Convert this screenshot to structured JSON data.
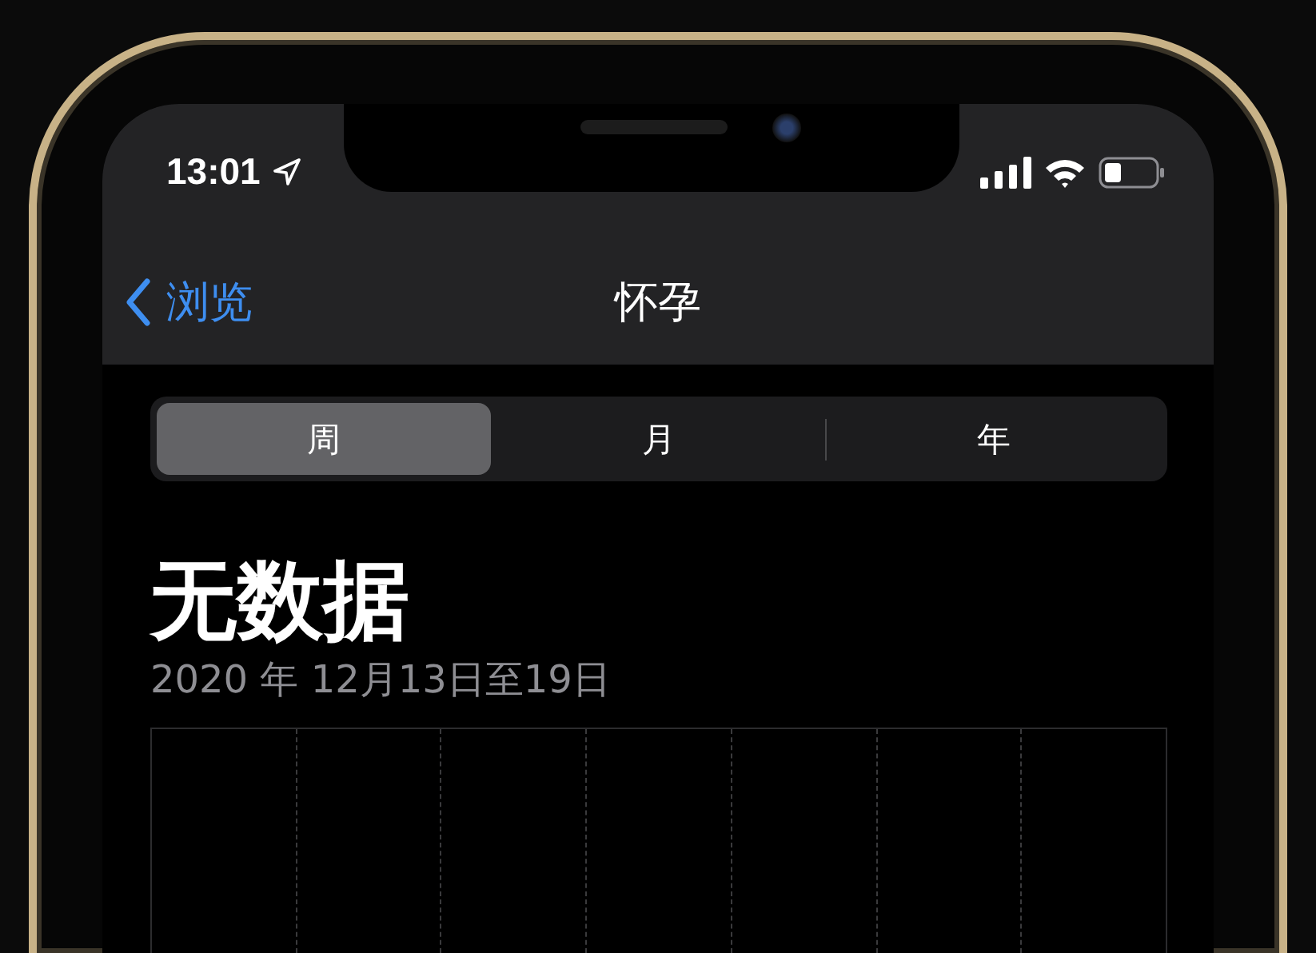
{
  "status_bar": {
    "time": "13:01"
  },
  "nav": {
    "back": "浏览",
    "title": "怀孕"
  },
  "segments": [
    {
      "label": "周",
      "selected": true
    },
    {
      "label": "月",
      "selected": false
    },
    {
      "label": "年",
      "selected": false
    }
  ],
  "summary": {
    "value": "无数据",
    "range": "2020 年 12月13日至19日"
  }
}
